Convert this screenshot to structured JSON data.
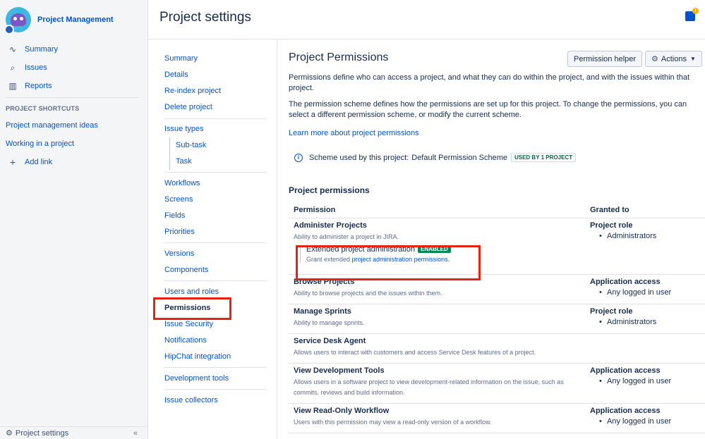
{
  "project": {
    "name": "Project Management"
  },
  "sidebar": {
    "nav": [
      {
        "label": "Summary",
        "icon": "activity-icon"
      },
      {
        "label": "Issues",
        "icon": "issues-icon"
      },
      {
        "label": "Reports",
        "icon": "reports-icon"
      }
    ],
    "shortcuts_heading": "PROJECT SHORTCUTS",
    "shortcuts": [
      "Project management ideas",
      "Working in a project"
    ],
    "add_link": "Add link",
    "footer": "Project settings"
  },
  "header": {
    "title": "Project settings",
    "notification_count": "1"
  },
  "settings_nav": {
    "groups": [
      [
        "Summary",
        "Details",
        "Re-index project",
        "Delete project"
      ],
      [
        "Issue types",
        "Sub-task",
        "Task"
      ],
      [
        "Workflows",
        "Screens",
        "Fields",
        "Priorities"
      ],
      [
        "Versions",
        "Components"
      ],
      [
        "Users and roles",
        "Permissions",
        "Issue Security",
        "Notifications",
        "HipChat integration"
      ],
      [
        "Development tools"
      ],
      [
        "Issue collectors"
      ]
    ],
    "active": "Permissions"
  },
  "main": {
    "title": "Project Permissions",
    "helper_button": "Permission helper",
    "actions_button": "Actions",
    "intro": "Permissions define who can access a project, and what they can do within the project, and with the issues within that project.",
    "scheme_text": "The permission scheme defines how the permissions are set up for this project. To change the permissions, you can select a different permission scheme, or modify the current scheme.",
    "learn_more": "Learn more about project permissions",
    "scheme_label": "Scheme used by this project:",
    "scheme_name": "Default Permission Scheme",
    "scheme_badge": "USED BY 1 PROJECT",
    "section_title": "Project permissions",
    "table": {
      "col_permission": "Permission",
      "col_granted": "Granted to",
      "rows": [
        {
          "name": "Administer Projects",
          "desc": "Ability to administer a project in JIRA.",
          "grant_type": "Project role",
          "grant_value": "Administrators"
        },
        {
          "name": "Browse Projects",
          "desc": "Ability to browse projects and the issues within them.",
          "grant_type": "Application access",
          "grant_value": "Any logged in user"
        },
        {
          "name": "Manage Sprints",
          "desc": "Ability to manage sprints.",
          "grant_type": "Project role",
          "grant_value": "Administrators"
        },
        {
          "name": "Service Desk Agent",
          "desc": "Allows users to interact with customers and access Service Desk features of a project.",
          "grant_type": "",
          "grant_value": ""
        },
        {
          "name": "View Development Tools",
          "desc": "Allows users in a software project to view development-related information on the issue, such as commits, reviews and build information.",
          "grant_type": "Application access",
          "grant_value": "Any logged in user"
        },
        {
          "name": "View Read-Only Workflow",
          "desc": "Users with this permission may view a read-only version of a workflow.",
          "grant_type": "Application access",
          "grant_value": "Any logged in user"
        }
      ],
      "extended": {
        "title": "Extended project administration",
        "badge": "ENABLED",
        "desc_prefix": "Grant extended",
        "desc_link": "project administration permissions."
      }
    }
  },
  "colors": {
    "accent": "#0052cc",
    "highlight": "#e5230f",
    "enabled": "#00875a"
  }
}
